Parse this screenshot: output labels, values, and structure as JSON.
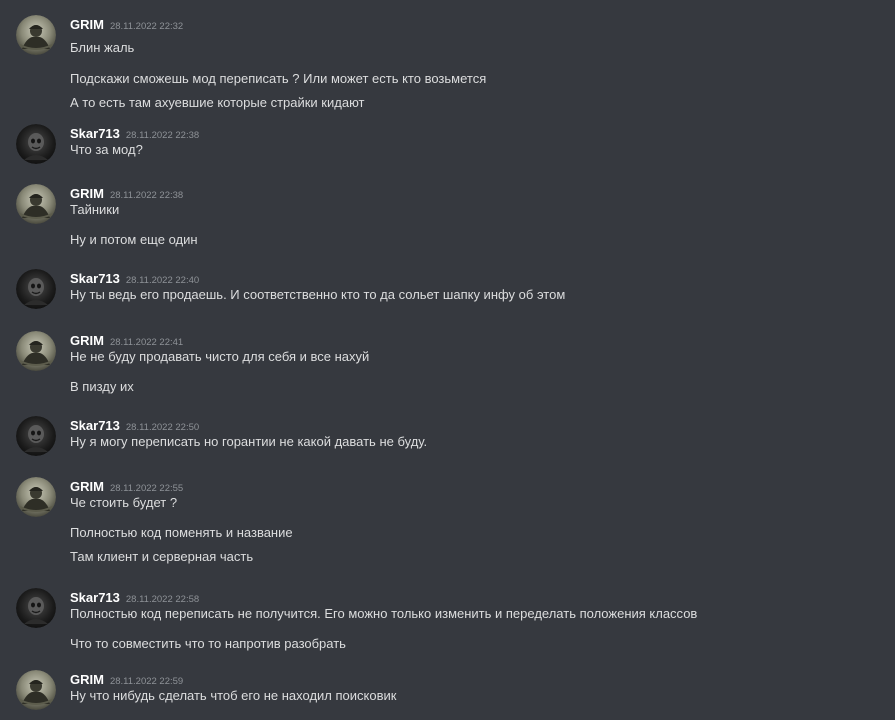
{
  "users": {
    "grim": {
      "name": "GRIM",
      "avatar_icon": "grim-avatar-icon"
    },
    "skar": {
      "name": "Skar713",
      "avatar_icon": "skar713-avatar-icon"
    }
  },
  "messages": [
    {
      "author": "GRIM",
      "timestamp": "28.11.2022 22:32",
      "lines": [
        "Блин жаль",
        "Подскажи сможешь мод переписать ? Или может есть кто возьмется",
        "А то есть там ахуевшие которые страйки кидают"
      ]
    },
    {
      "author": "Skar713",
      "timestamp": "28.11.2022 22:38",
      "lines": [
        "Что за мод?"
      ]
    },
    {
      "author": "GRIM",
      "timestamp": "28.11.2022 22:38",
      "lines": [
        "Тайники",
        "Ну и потом еще один"
      ]
    },
    {
      "author": "Skar713",
      "timestamp": "28.11.2022 22:40",
      "lines": [
        "Ну ты ведь его продаешь. И соответственно кто то да сольет шапку инфу об этом"
      ]
    },
    {
      "author": "GRIM",
      "timestamp": "28.11.2022 22:41",
      "lines": [
        "Не не буду продавать чисто для себя и все нахуй",
        "В пизду их"
      ]
    },
    {
      "author": "Skar713",
      "timestamp": "28.11.2022 22:50",
      "lines": [
        "Ну я могу переписать но горантии не какой давать не буду."
      ]
    },
    {
      "author": "GRIM",
      "timestamp": "28.11.2022 22:55",
      "lines": [
        "Че стоить будет ?",
        "Полностью код поменять и название",
        "Там клиент и серверная часть"
      ]
    },
    {
      "author": "Skar713",
      "timestamp": "28.11.2022 22:58",
      "lines": [
        "Полностью код переписать не получится. Его можно только изменить и переделать положения классов",
        "Что то совместить что то напротив разобрать"
      ]
    },
    {
      "author": "GRIM",
      "timestamp": "28.11.2022 22:59",
      "lines": [
        "Ну что нибудь сделать чтоб его не находил поисковик"
      ]
    }
  ],
  "colors": {
    "background": "#36393f",
    "author": "#ffffff",
    "timestamp": "#8e9297",
    "text": "#dcddde"
  }
}
